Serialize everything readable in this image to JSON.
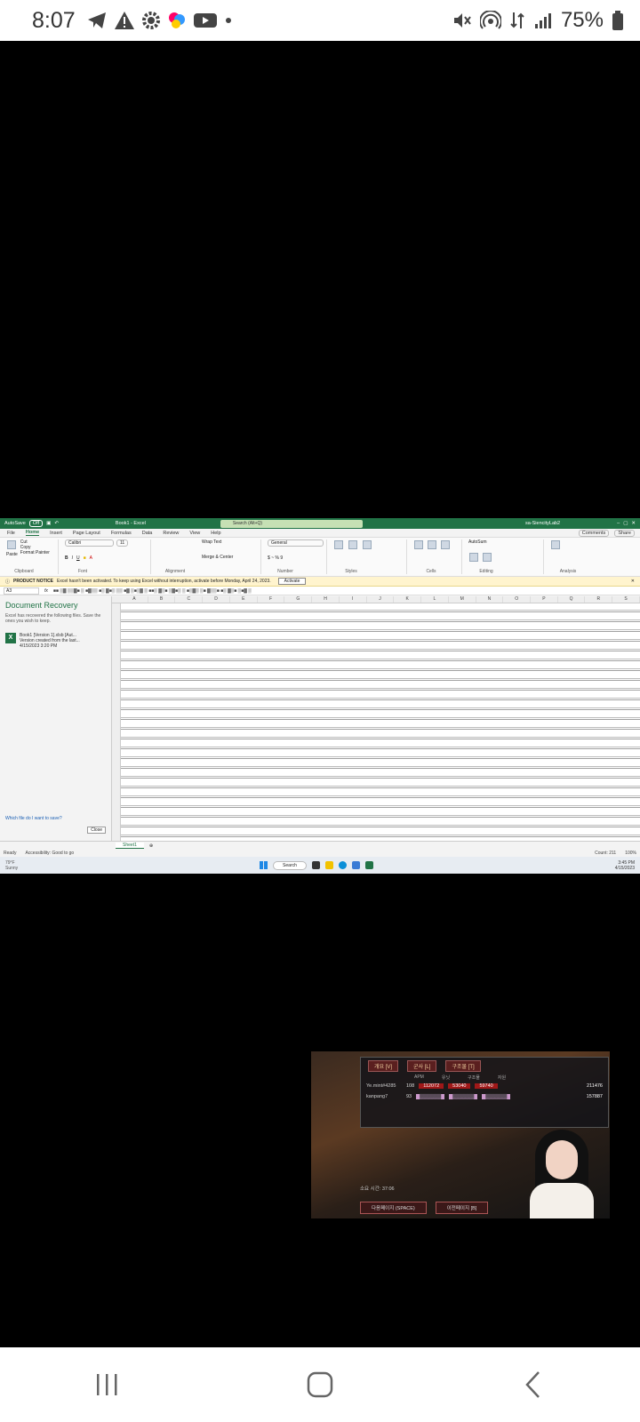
{
  "status_bar": {
    "time": "8:07",
    "battery": "75%",
    "left_icons": [
      "telegram-icon",
      "warning-icon",
      "settings-gear-icon",
      "app-icon",
      "youtube-icon",
      "dot-icon"
    ],
    "right_icons": [
      "mute-icon",
      "hotspot-icon",
      "data-icon",
      "signal-icon",
      "battery-icon"
    ]
  },
  "excel": {
    "autosave": "AutoSave",
    "autosave_state": "Off",
    "title": "Book1 - Excel",
    "search": "Search (Alt+Q)",
    "user": "sa-SiencityLab2",
    "tabs": [
      "File",
      "Home",
      "Insert",
      "Page Layout",
      "Formulas",
      "Data",
      "Review",
      "View",
      "Help"
    ],
    "active_tab": "Home",
    "comments": "Comments",
    "share": "Share",
    "ribbon_groups": [
      "Clipboard",
      "Font",
      "Alignment",
      "Number",
      "Styles",
      "Cells",
      "Editing",
      "Analysis"
    ],
    "font_name": "Calibri",
    "font_size": "11",
    "number_format": "General",
    "clipboard": {
      "paste": "Paste",
      "cut": "Cut",
      "copy": "Copy",
      "format_painter": "Format Painter"
    },
    "alignment": {
      "wrap": "Wrap Text",
      "merge": "Merge & Center"
    },
    "styles": [
      "Conditional Formatting",
      "Format as Table",
      "Cell Styles"
    ],
    "cells": [
      "Insert",
      "Delete",
      "Format"
    ],
    "editing": [
      "AutoSum",
      "Fill",
      "Clear",
      "Sort & Filter",
      "Find & Select"
    ],
    "analysis": "Analyze Data",
    "notice_label": "PRODUCT NOTICE",
    "notice_text": "Excel hasn't been activated. To keep using Excel without interruption, activate before Monday, April 24, 2023.",
    "activate": "Activate",
    "name_box": "A3",
    "fx": "fx",
    "recovery": {
      "title": "Document Recovery",
      "sub": "Excel has recovered the following files. Save the ones you wish to keep.",
      "file_name": "Book1 [Version 1].xlsb [Aut...",
      "file_desc": "Version created from the last...",
      "file_time": "4/15/2023 3:20 PM",
      "link": "Which file do I want to save?",
      "close": "Close"
    },
    "columns": [
      "A",
      "B",
      "C",
      "D",
      "E",
      "F",
      "G",
      "H",
      "I",
      "J",
      "K",
      "L",
      "M",
      "N",
      "O",
      "P",
      "Q",
      "R",
      "S"
    ],
    "sheet": "Sheet1",
    "status_ready": "Ready",
    "status_access": "Accessibility: Good to go",
    "status_count": "Count: 211",
    "zoom": "100%",
    "weather_temp": "79°F",
    "weather_desc": "Sunny",
    "taskbar_search": "Search",
    "clock_time": "3:45 PM",
    "clock_date": "4/15/2023"
  },
  "game": {
    "header_tabs": [
      "개요 [V]",
      "군사 [L]",
      "구조물 [T]"
    ],
    "col_labels": [
      "APM",
      "유닛",
      "구조물",
      "자원"
    ],
    "players": [
      {
        "name": "Ye.mint#4285",
        "apm": "108",
        "v1": "112072",
        "v2": "53040",
        "v3": "59740",
        "total": "211476"
      },
      {
        "name": "kanpang7",
        "apm": "93",
        "v1": "",
        "v2": "",
        "v3": "",
        "total": "157887"
      }
    ],
    "timer": "소요 시간: 37:06",
    "button_left": "다음페이지 (SPACE)",
    "button_right": "이전페이지 [B]"
  }
}
